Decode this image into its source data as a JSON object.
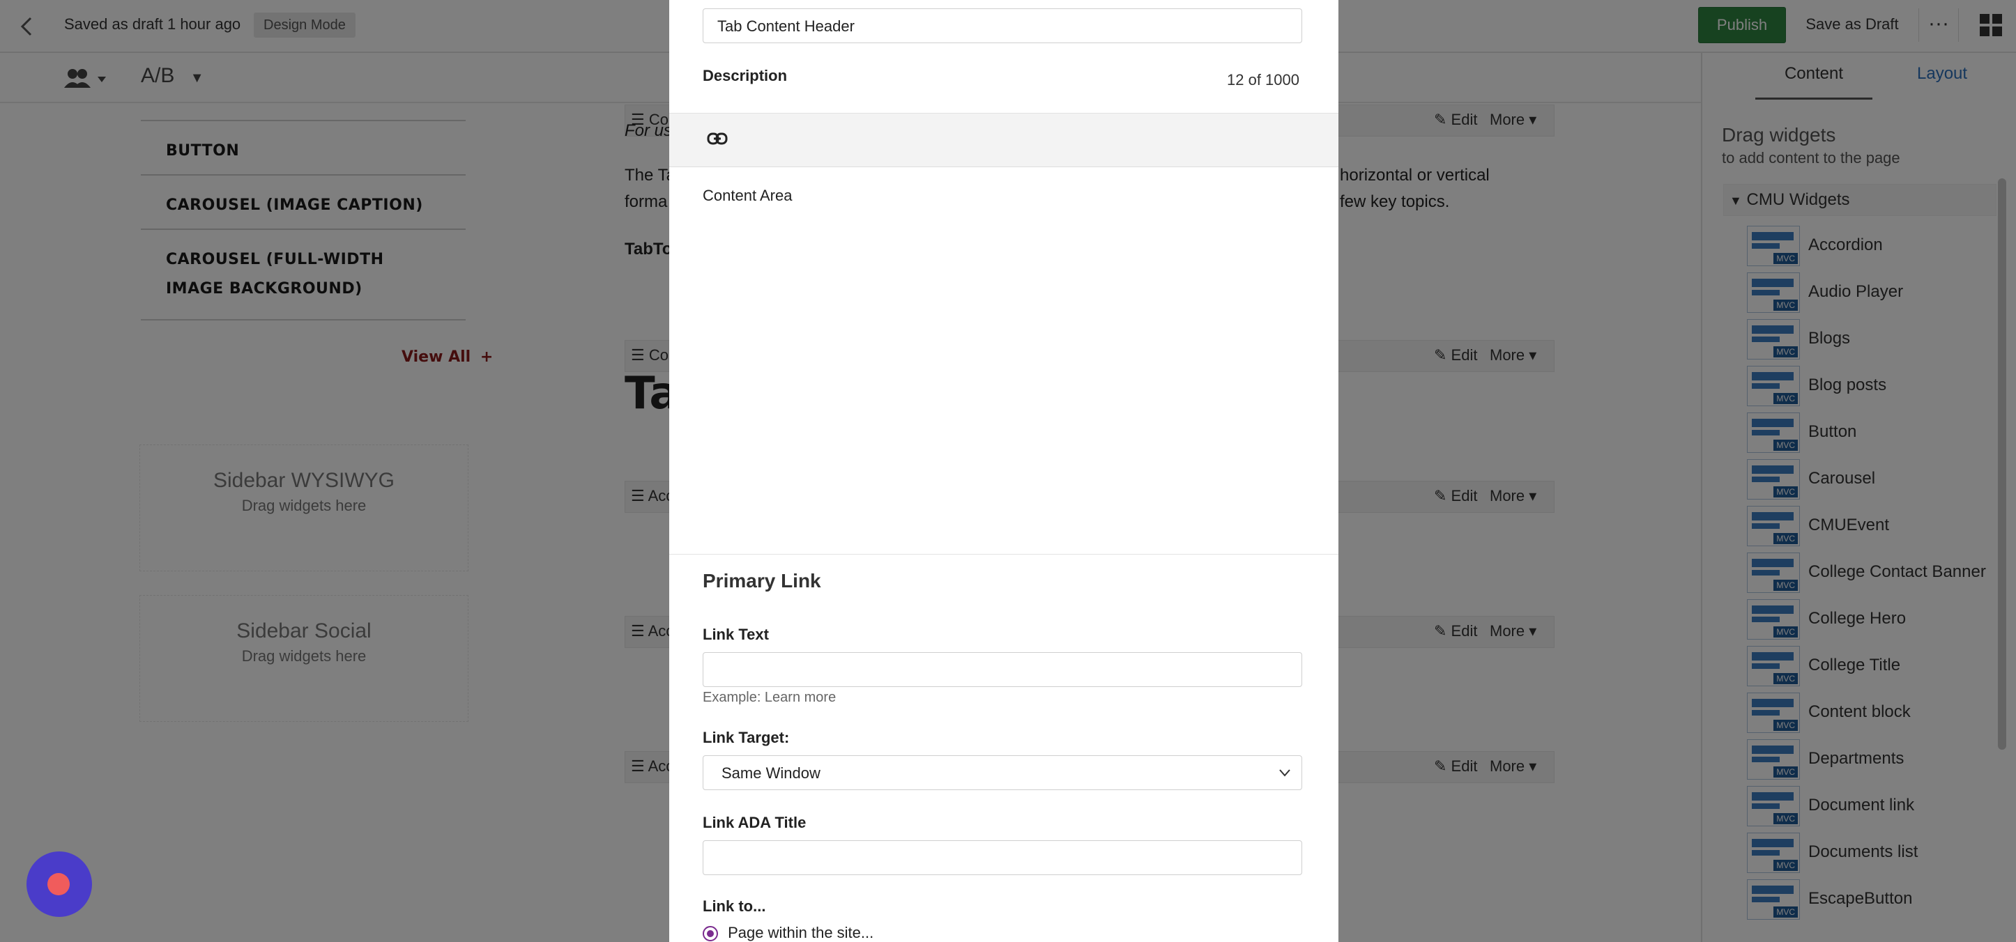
{
  "topbar": {
    "back_icon": "chevron-left",
    "saved_text": "Saved as draft 1 hour ago",
    "mode_badge": "Design Mode",
    "publish_label": "Publish",
    "save_draft_label": "Save as Draft",
    "more_icon": "···",
    "publish_color": "#2e8540"
  },
  "subbar": {
    "persona_icon": "users-icon",
    "ab_label": "A/B"
  },
  "canvas": {
    "nav_items": [
      {
        "label": "BUTTON"
      },
      {
        "label": "CAROUSEL (IMAGE CAPTION)"
      },
      {
        "label": "CAROUSEL (FULL-WIDTH IMAGE BACKGROUND)"
      }
    ],
    "view_all": "View All",
    "view_all_plus": "+",
    "dropzones": [
      {
        "title": "Sidebar WYSIWYG",
        "sub": "Drag widgets here"
      },
      {
        "title": "Sidebar Social",
        "sub": "Drag widgets here"
      }
    ],
    "widget_bars": [
      {
        "head": "Co",
        "edit": "Edit",
        "more": "More"
      },
      {
        "head": "Co",
        "edit": "Edit",
        "more": "More"
      },
      {
        "head": "Acc",
        "edit": "Edit",
        "more": "More"
      },
      {
        "head": "Acc",
        "edit": "Edit",
        "more": "More"
      },
      {
        "head": "Acc",
        "edit": "Edit",
        "more": "More"
      }
    ],
    "text_line_1a": "For us",
    "text_line_2a": "The Ta",
    "text_line_2b": "horizontal or vertical",
    "text_line_3a": "forma",
    "text_line_3b": "few key topics.",
    "text_line_4": "TabTo",
    "big_heading": "Ta"
  },
  "rpanel": {
    "tab_content": "Content",
    "tab_layout": "Layout",
    "drag_title": "Drag widgets",
    "drag_sub": "to add content to the page",
    "group_label": "CMU Widgets",
    "mvc_badge": "MVC",
    "widgets": [
      "Accordion",
      "Audio Player",
      "Blogs",
      "Blog posts",
      "Button",
      "Carousel",
      "CMUEvent",
      "College Contact Banner",
      "College Hero",
      "College Title",
      "Content block",
      "Departments",
      "Document link",
      "Documents list",
      "EscapeButton"
    ]
  },
  "modal": {
    "header_value": "Tab Content Header",
    "description_label": "Description",
    "description_counter": "12 of 1000",
    "link_icon": "link-icon",
    "content_area_label": "Content Area",
    "primary_link_title": "Primary Link",
    "link_text_label": "Link Text",
    "link_text_value": "",
    "link_text_hint": "Example: Learn more",
    "link_target_label": "Link Target:",
    "link_target_value": "Same Window",
    "link_ada_label": "Link ADA Title",
    "link_ada_value": "",
    "link_to_label": "Link to...",
    "radio_page_label": "Page within the site..."
  }
}
